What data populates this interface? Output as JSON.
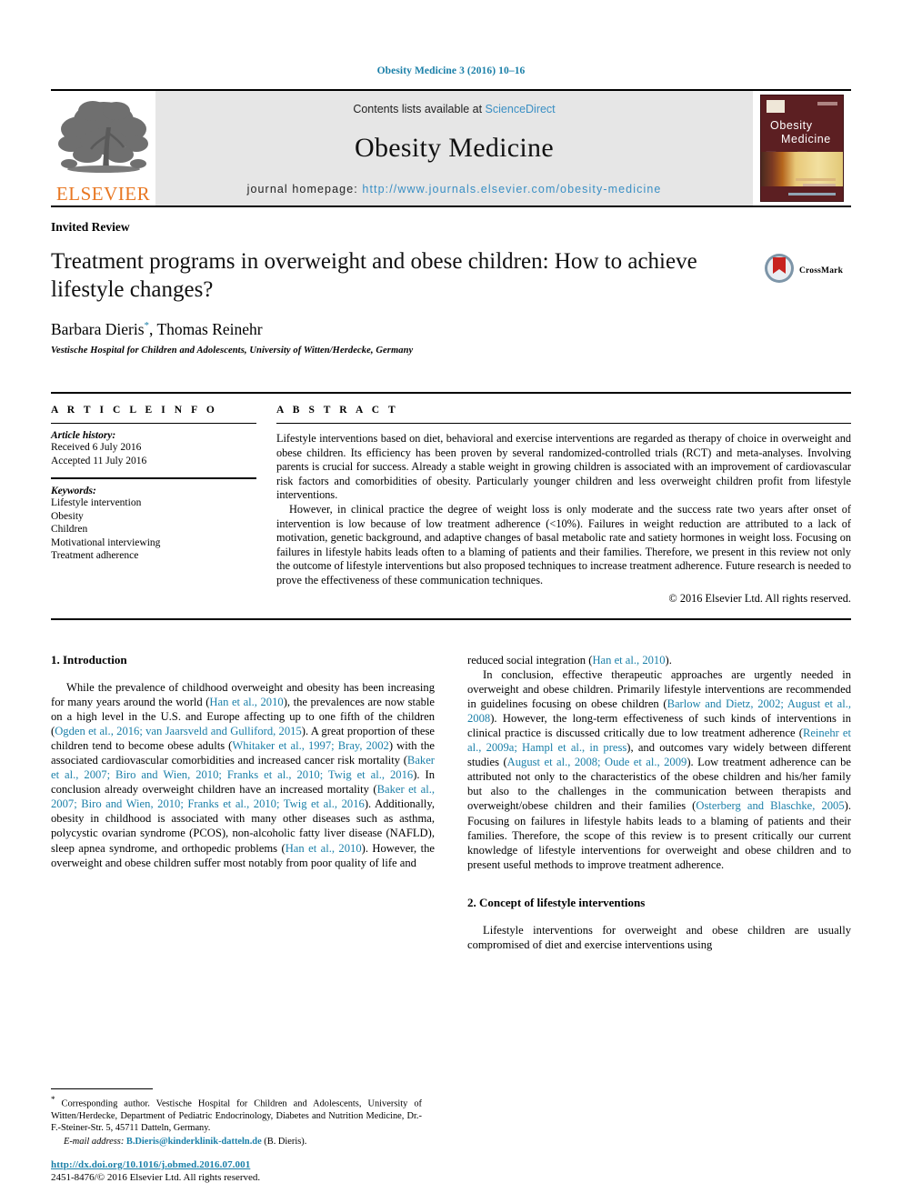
{
  "running_head": "Obesity Medicine 3 (2016) 10–16",
  "banner": {
    "contents_prefix": "Contents lists available at ",
    "contents_link": "ScienceDirect",
    "journal_title": "Obesity Medicine",
    "homepage_label": "journal homepage:",
    "homepage_url": "http://www.journals.elsevier.com/obesity-medicine",
    "publisher": "ELSEVIER",
    "cover_title_line1": "Obesity",
    "cover_title_line2": "Medicine"
  },
  "article": {
    "type": "Invited Review",
    "title": "Treatment programs in overweight and obese children: How to achieve lifestyle changes?",
    "authors": "Barbara Dieris",
    "authors_rest": ", Thomas Reinehr",
    "corresponding_marker": "*",
    "affiliation": "Vestische Hospital for Children and Adolescents, University of Witten/Herdecke, Germany",
    "crossmark_label": "CrossMark"
  },
  "article_info": {
    "heading": "A R T I C L E  I N F O",
    "history_label": "Article history:",
    "history": [
      "Received 6 July 2016",
      "Accepted 11 July 2016"
    ],
    "keywords_label": "Keywords:",
    "keywords": [
      "Lifestyle intervention",
      "Obesity",
      "Children",
      "Motivational interviewing",
      "Treatment adherence"
    ]
  },
  "abstract": {
    "heading": "A B S T R A C T",
    "paragraph1": "Lifestyle interventions based on diet, behavioral and exercise interventions are regarded as therapy of choice in overweight and obese children. Its efficiency has been proven by several randomized-controlled trials (RCT) and meta-analyses. Involving parents is crucial for success. Already a stable weight in growing children is associated with an improvement of cardiovascular risk factors and comorbidities of obesity. Particularly younger children and less overweight children profit from lifestyle interventions.",
    "paragraph2": "However, in clinical practice the degree of weight loss is only moderate and the success rate two years after onset of intervention is low because of low treatment adherence (<10%). Failures in weight reduction are attributed to a lack of motivation, genetic background, and adaptive changes of basal metabolic rate and satiety hormones in weight loss. Focusing on failures in lifestyle habits leads often to a blaming of patients and their families. Therefore, we present in this review not only the outcome of lifestyle interventions but also proposed techniques to increase treatment adherence. Future research is needed to prove the effectiveness of these communication techniques.",
    "copyright": "© 2016 Elsevier Ltd. All rights reserved."
  },
  "sections": {
    "intro_heading": "1. Introduction",
    "concept_heading": "2. Concept of lifestyle interventions"
  },
  "body": {
    "left_p1_a": "While the prevalence of childhood overweight and obesity has been increasing for many years around the world (",
    "ref_han2010": "Han et al., 2010",
    "left_p1_b": "), the prevalences are now stable on a high level in the U.S. and Europe affecting up to one fifth of the children (",
    "ref_ogden": "Ogden et al., 2016; van Jaarsveld and Gulliford, 2015",
    "left_p1_c": "). A great proportion of these children tend to become obese adults (",
    "ref_whitaker": "Whitaker et al., 1997; Bray, 2002",
    "left_p1_d": ") with the associated cardiovascular comorbidities and increased cancer risk mortality (",
    "ref_baker1": "Baker et al., 2007; Biro and Wien, 2010; Franks et al., 2010; Twig et al., 2016",
    "left_p1_e": "). In conclusion already overweight children have an increased mortality (",
    "ref_baker2": "Baker et al., 2007; Biro and Wien, 2010; Franks et al., 2010; Twig et al., 2016",
    "left_p1_f": "). Additionally, obesity in childhood is associated with many other diseases such as asthma, polycystic ovarian syndrome (PCOS), non-alcoholic fatty liver disease (NAFLD), sleep apnea syndrome, and orthopedic problems (",
    "ref_han2010b": "Han et al., 2010",
    "left_p1_g": "). However, the overweight and obese children suffer most notably from poor quality of life and",
    "right_p1_a": "reduced social integration (",
    "ref_han2010c": "Han et al., 2010",
    "right_p1_b": ").",
    "right_p2_a": "In conclusion, effective therapeutic approaches are urgently needed in overweight and obese children. Primarily lifestyle interventions are recommended in guidelines focusing on obese children (",
    "ref_barlow": "Barlow and Dietz, 2002; August et al., 2008",
    "right_p2_b": "). However, the long-term effectiveness of such kinds of interventions in clinical practice is discussed critically due to low treatment adherence (",
    "ref_reinehr": "Reinehr et al., 2009a; Hampl et al., in press",
    "right_p2_c": "), and outcomes vary widely between different studies (",
    "ref_august": "August et al., 2008; Oude et al., 2009",
    "right_p2_d": "). Low treatment adherence can be attributed not only to the characteristics of the obese children and his/her family but also to the challenges in the communication between therapists and overweight/obese children and their families (",
    "ref_osterberg": "Osterberg and Blaschke, 2005",
    "right_p2_e": "). Focusing on failures in lifestyle habits leads to a blaming of patients and their families. Therefore, the scope of this review is to present critically our current knowledge of lifestyle interventions for overweight and obese children and to present useful methods to improve treatment adherence.",
    "right_p3": "Lifestyle interventions for overweight and obese children are usually compromised of diet and exercise interventions using"
  },
  "footnote": {
    "marker": "*",
    "text": " Corresponding author. Vestische Hospital for Children and Adolescents, University of Witten/Herdecke, Department of Pediatric Endocrinology, Diabetes and Nutrition Medicine, Dr.-F.-Steiner-Str. 5, 45711 Datteln, Germany.",
    "email_label": "E-mail address:",
    "email": "B.Dieris@kinderklinik-datteln.de",
    "email_suffix": " (B. Dieris)."
  },
  "doi": {
    "url": "http://dx.doi.org/10.1016/j.obmed.2016.07.001",
    "issn_line": "2451-8476/© 2016 Elsevier Ltd. All rights reserved."
  },
  "colors": {
    "link_blue": "#1a7fa8",
    "banner_grey": "#e6e6e6",
    "elsevier_orange": "#E87722",
    "cover_maroon": "#5c1f22"
  }
}
